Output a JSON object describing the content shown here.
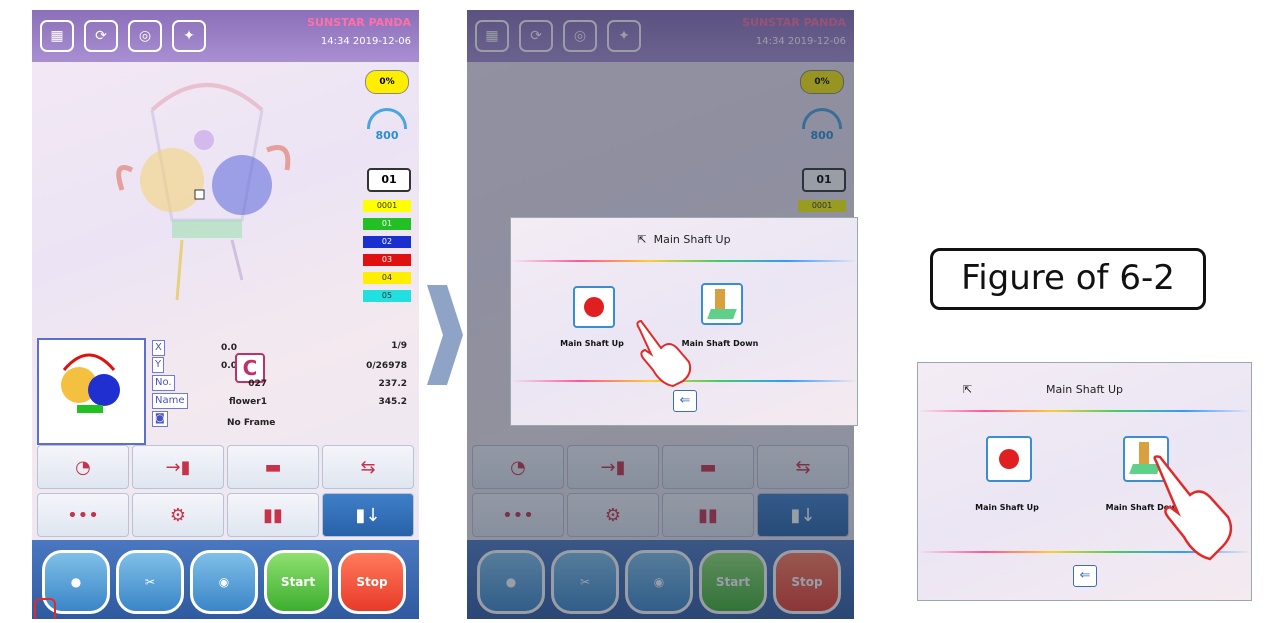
{
  "screen": {
    "brand": "SUNSTAR PANDA",
    "time": "14:34",
    "date": "2019-12-06",
    "progress": "0%",
    "speed": "800",
    "needle": "01",
    "color_steps": [
      {
        "label": "0001",
        "color": "#ffff00"
      },
      {
        "label": "01",
        "color": "#22c022"
      },
      {
        "label": "02",
        "color": "#1a2fd0"
      },
      {
        "label": "03",
        "color": "#e01010"
      },
      {
        "label": "04",
        "color": "#ffee00"
      },
      {
        "label": "05",
        "color": "#22e0e0"
      }
    ],
    "info": {
      "x_label": "X",
      "x_value": "0.0",
      "y_label": "Y",
      "y_value": "0.0",
      "no_label": "No.",
      "no_value": "027",
      "name_label": "Name",
      "name_value": "flower1",
      "frame": "No Frame",
      "colors_count": "1/9",
      "stitches": "0/26978",
      "width": "237.2",
      "height": "345.2"
    },
    "start_label": "Start",
    "stop_label": "Stop"
  },
  "dialog": {
    "title": "Main Shaft Up",
    "up_label": "Main Shaft Up",
    "down_label": "Main Shaft Down",
    "exit_icon": "exit-icon"
  },
  "figure_caption": "Figure of 6-2",
  "colors": {
    "accent": "#3a8ed0",
    "topbar": "#8b6fb8",
    "start": "#3dae2f",
    "stop": "#e83a2a",
    "pointer": "#e02b2b"
  }
}
